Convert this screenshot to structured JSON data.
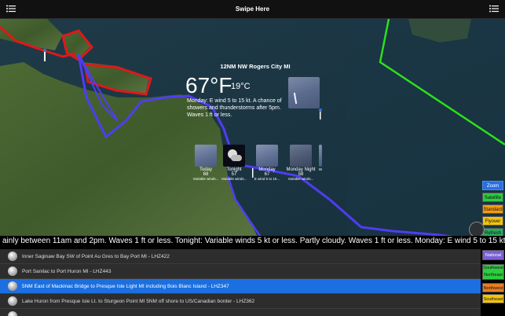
{
  "header": {
    "title": "Swipe Here",
    "left_menu_icon": "list-icon",
    "right_menu_icon": "list-icon"
  },
  "forecast": {
    "location": "12NM NW Rogers City MI",
    "temp_f": "67°F",
    "temp_c": "19°C",
    "text": "Monday: E wind 5 to 15 kt. A chance of showers and thunderstorms after 5pm. Waves 1 ft or less.",
    "icon": "thunderstorm-icon",
    "periods": [
      {
        "name": "Today",
        "temp": "68",
        "desc": "Variable winds...",
        "icon": "thunderstorm-icon"
      },
      {
        "name": "Tonight",
        "temp": "57",
        "desc": "Variable winds...",
        "icon": "partly-cloudy-night-icon"
      },
      {
        "name": "Monday",
        "temp": "67",
        "desc": "E wind 5 to 15...",
        "icon": "thunderstorm-icon"
      },
      {
        "name": "Monday Night",
        "temp": "58",
        "desc": "Variable winds...",
        "icon": "thunderstorm-icon"
      },
      {
        "name": "",
        "temp": "",
        "desc": "W",
        "icon": "thunderstorm-icon"
      }
    ]
  },
  "map_controls": {
    "zoom": "Zoom",
    "satellite": "Satellite",
    "standard": "Standard",
    "flyover": "Flyover",
    "refresh": "Refresh",
    "three_d": "3D"
  },
  "ticker": {
    "text": "ainly between 11am and 2pm.  Waves 1 ft or less. Tonight: Variable winds 5 kt or less. Partly cloudy. Waves 1 ft or less. Monday: E wind 5 to 15 kt"
  },
  "zones": [
    {
      "label": "Inner Saginaw Bay SW of Point Au Gres to Bay Port MI - LHZ422",
      "selected": false
    },
    {
      "label": "Port Sanilac to Port Huron MI - LHZ443",
      "selected": false
    },
    {
      "label": "5NM East of Mackinac Bridge to Presque Isle Light MI including Bois Blanc Island - LHZ347",
      "selected": true
    },
    {
      "label": "Lake Huron from Presque Isle Lt. to Sturgeon Point  MI 5NM off shore to US/Canadian border - LHZ362",
      "selected": false
    },
    {
      "label": "",
      "selected": false
    }
  ],
  "regions": {
    "national": "National",
    "southwest": "Southwest",
    "northeast": "Northeast",
    "northwest": "Northwest",
    "southeast": "Southeast"
  },
  "colors": {
    "zoom": "#2a6ee0",
    "satellite": "#2ecc40",
    "standard": "#f39c12",
    "flyover": "#f1c40f",
    "refresh": "#27ae60",
    "national": "#7b5fd6",
    "southwest": "#2ecc40",
    "northwest": "#e67e22",
    "southeast": "#f1c40f",
    "selected_row": "#1b6fe0"
  }
}
